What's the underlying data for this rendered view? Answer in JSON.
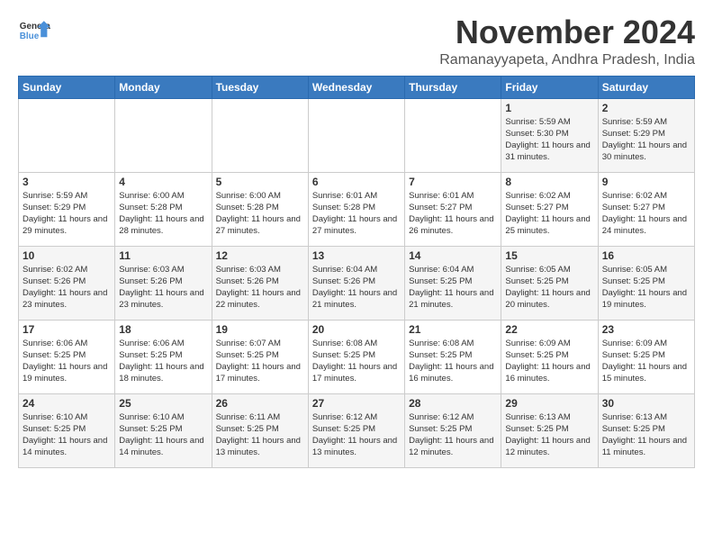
{
  "logo": {
    "text_general": "General",
    "text_blue": "Blue"
  },
  "header": {
    "month_year": "November 2024",
    "location": "Ramanayyapeta, Andhra Pradesh, India"
  },
  "weekdays": [
    "Sunday",
    "Monday",
    "Tuesday",
    "Wednesday",
    "Thursday",
    "Friday",
    "Saturday"
  ],
  "weeks": [
    [
      {
        "day": "",
        "info": ""
      },
      {
        "day": "",
        "info": ""
      },
      {
        "day": "",
        "info": ""
      },
      {
        "day": "",
        "info": ""
      },
      {
        "day": "",
        "info": ""
      },
      {
        "day": "1",
        "info": "Sunrise: 5:59 AM\nSunset: 5:30 PM\nDaylight: 11 hours and 31 minutes."
      },
      {
        "day": "2",
        "info": "Sunrise: 5:59 AM\nSunset: 5:29 PM\nDaylight: 11 hours and 30 minutes."
      }
    ],
    [
      {
        "day": "3",
        "info": "Sunrise: 5:59 AM\nSunset: 5:29 PM\nDaylight: 11 hours and 29 minutes."
      },
      {
        "day": "4",
        "info": "Sunrise: 6:00 AM\nSunset: 5:28 PM\nDaylight: 11 hours and 28 minutes."
      },
      {
        "day": "5",
        "info": "Sunrise: 6:00 AM\nSunset: 5:28 PM\nDaylight: 11 hours and 27 minutes."
      },
      {
        "day": "6",
        "info": "Sunrise: 6:01 AM\nSunset: 5:28 PM\nDaylight: 11 hours and 27 minutes."
      },
      {
        "day": "7",
        "info": "Sunrise: 6:01 AM\nSunset: 5:27 PM\nDaylight: 11 hours and 26 minutes."
      },
      {
        "day": "8",
        "info": "Sunrise: 6:02 AM\nSunset: 5:27 PM\nDaylight: 11 hours and 25 minutes."
      },
      {
        "day": "9",
        "info": "Sunrise: 6:02 AM\nSunset: 5:27 PM\nDaylight: 11 hours and 24 minutes."
      }
    ],
    [
      {
        "day": "10",
        "info": "Sunrise: 6:02 AM\nSunset: 5:26 PM\nDaylight: 11 hours and 23 minutes."
      },
      {
        "day": "11",
        "info": "Sunrise: 6:03 AM\nSunset: 5:26 PM\nDaylight: 11 hours and 23 minutes."
      },
      {
        "day": "12",
        "info": "Sunrise: 6:03 AM\nSunset: 5:26 PM\nDaylight: 11 hours and 22 minutes."
      },
      {
        "day": "13",
        "info": "Sunrise: 6:04 AM\nSunset: 5:26 PM\nDaylight: 11 hours and 21 minutes."
      },
      {
        "day": "14",
        "info": "Sunrise: 6:04 AM\nSunset: 5:25 PM\nDaylight: 11 hours and 21 minutes."
      },
      {
        "day": "15",
        "info": "Sunrise: 6:05 AM\nSunset: 5:25 PM\nDaylight: 11 hours and 20 minutes."
      },
      {
        "day": "16",
        "info": "Sunrise: 6:05 AM\nSunset: 5:25 PM\nDaylight: 11 hours and 19 minutes."
      }
    ],
    [
      {
        "day": "17",
        "info": "Sunrise: 6:06 AM\nSunset: 5:25 PM\nDaylight: 11 hours and 19 minutes."
      },
      {
        "day": "18",
        "info": "Sunrise: 6:06 AM\nSunset: 5:25 PM\nDaylight: 11 hours and 18 minutes."
      },
      {
        "day": "19",
        "info": "Sunrise: 6:07 AM\nSunset: 5:25 PM\nDaylight: 11 hours and 17 minutes."
      },
      {
        "day": "20",
        "info": "Sunrise: 6:08 AM\nSunset: 5:25 PM\nDaylight: 11 hours and 17 minutes."
      },
      {
        "day": "21",
        "info": "Sunrise: 6:08 AM\nSunset: 5:25 PM\nDaylight: 11 hours and 16 minutes."
      },
      {
        "day": "22",
        "info": "Sunrise: 6:09 AM\nSunset: 5:25 PM\nDaylight: 11 hours and 16 minutes."
      },
      {
        "day": "23",
        "info": "Sunrise: 6:09 AM\nSunset: 5:25 PM\nDaylight: 11 hours and 15 minutes."
      }
    ],
    [
      {
        "day": "24",
        "info": "Sunrise: 6:10 AM\nSunset: 5:25 PM\nDaylight: 11 hours and 14 minutes."
      },
      {
        "day": "25",
        "info": "Sunrise: 6:10 AM\nSunset: 5:25 PM\nDaylight: 11 hours and 14 minutes."
      },
      {
        "day": "26",
        "info": "Sunrise: 6:11 AM\nSunset: 5:25 PM\nDaylight: 11 hours and 13 minutes."
      },
      {
        "day": "27",
        "info": "Sunrise: 6:12 AM\nSunset: 5:25 PM\nDaylight: 11 hours and 13 minutes."
      },
      {
        "day": "28",
        "info": "Sunrise: 6:12 AM\nSunset: 5:25 PM\nDaylight: 11 hours and 12 minutes."
      },
      {
        "day": "29",
        "info": "Sunrise: 6:13 AM\nSunset: 5:25 PM\nDaylight: 11 hours and 12 minutes."
      },
      {
        "day": "30",
        "info": "Sunrise: 6:13 AM\nSunset: 5:25 PM\nDaylight: 11 hours and 11 minutes."
      }
    ]
  ]
}
